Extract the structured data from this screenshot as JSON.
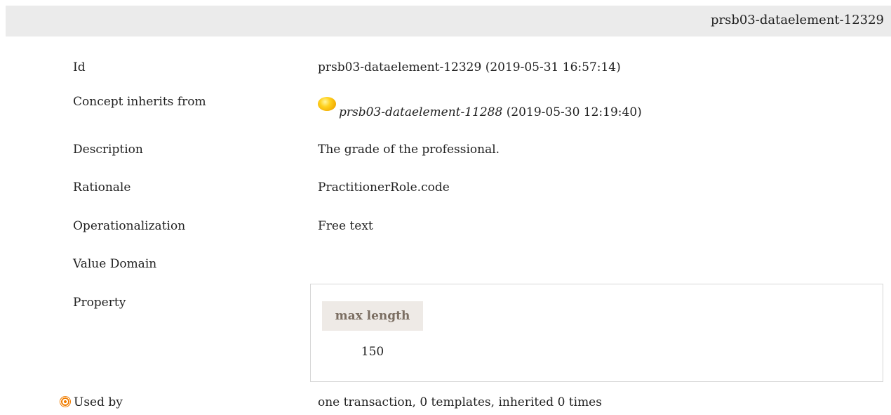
{
  "header": {
    "element_id": "prsb03-dataelement-12329"
  },
  "rows": {
    "id": {
      "label": "Id",
      "value": "prsb03-dataelement-12329 (2019-05-31 16:57:14)"
    },
    "inherits": {
      "label": "Concept inherits from",
      "link": "prsb03-dataelement-11288",
      "value": "(2019-05-30 12:19:40)"
    },
    "description": {
      "label": "Description",
      "value": "The grade of the professional."
    },
    "rationale": {
      "label": "Rationale",
      "value": "PractitionerRole.code"
    },
    "operationalization": {
      "label": "Operationalization",
      "value": "Free text"
    },
    "value_domain": {
      "label": "Value Domain"
    },
    "property": {
      "label": "Property",
      "header": "max length",
      "value": "150"
    },
    "used_by": {
      "label": "Used by",
      "value": "one transaction, 0 templates, inherited 0 times"
    }
  },
  "icons": {
    "inherit": "yellow-orb-icon",
    "used_by": "target-icon",
    "accent": "#f07d00"
  }
}
